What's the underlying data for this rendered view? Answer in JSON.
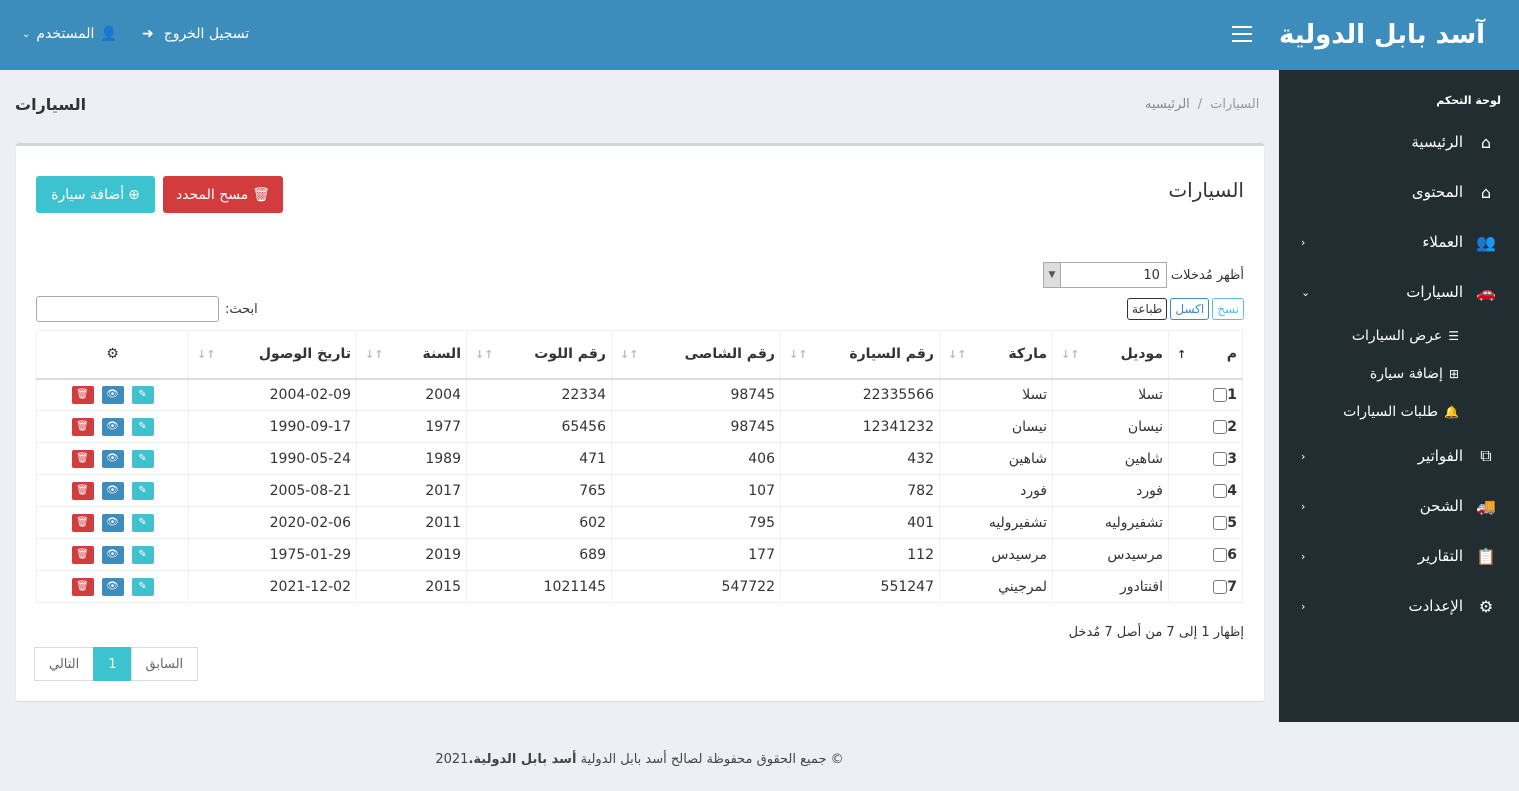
{
  "brand": "آسد بابل الدولية",
  "header": {
    "user_label": "المستخدم",
    "logout_label": "تسجيل الخروج"
  },
  "sidebar": {
    "heading": "لوحة التحكم",
    "items": [
      {
        "label": "الرئيسية",
        "icon": "home-icon"
      },
      {
        "label": "المحتوى",
        "icon": "home-icon"
      },
      {
        "label": "العملاء",
        "icon": "users-icon"
      },
      {
        "label": "السيارات",
        "icon": "car-icon"
      },
      {
        "label": "الفواتير",
        "icon": "copy-icon"
      },
      {
        "label": "الشحن",
        "icon": "truck-icon"
      },
      {
        "label": "التقارير",
        "icon": "clipboard-icon"
      },
      {
        "label": "الإعدادت",
        "icon": "gear-icon"
      }
    ],
    "subitems": [
      {
        "label": "عرض السيارات",
        "icon": "list-icon"
      },
      {
        "label": "إضافة سيارة",
        "icon": "plus-square-icon"
      },
      {
        "label": "طلبات السيارات",
        "icon": "bell-icon"
      }
    ]
  },
  "page": {
    "title": "السيارات",
    "breadcrumb": [
      "الرئيسيه",
      "السيارات"
    ]
  },
  "box": {
    "title": "السيارات",
    "add_button": "أضافة سيارة",
    "delete_button": "مسح المحدد",
    "length_label": "أظهر مُدخلات",
    "length_value": "10",
    "search_label": "ابحث:",
    "export": {
      "copy": "نسخ",
      "excel": "اكسل",
      "print": "طباعة"
    },
    "info": "إظهار 1 إلى 7 من أصل 7 مُدخل",
    "pager": {
      "prev": "السابق",
      "current": "1",
      "next": "التالي"
    }
  },
  "table": {
    "columns": [
      "م",
      "موديل",
      "ماركة",
      "رقم السيارة",
      "رقم الشاصى",
      "رقم اللوت",
      "السنة",
      "تاريخ الوصول"
    ],
    "rows": [
      [
        "1",
        "تسلا",
        "تسلا",
        "22335566",
        "98745",
        "22334",
        "2004",
        "2004-02-09"
      ],
      [
        "2",
        "نيسان",
        "نيسان",
        "12341232",
        "98745",
        "65456",
        "1977",
        "1990-09-17"
      ],
      [
        "3",
        "شاهين",
        "شاهين",
        "432",
        "406",
        "471",
        "1989",
        "1990-05-24"
      ],
      [
        "4",
        "فورد",
        "فورد",
        "782",
        "107",
        "765",
        "2017",
        "2005-08-21"
      ],
      [
        "5",
        "تشفيروليه",
        "تشفيروليه",
        "401",
        "795",
        "602",
        "2011",
        "2020-02-06"
      ],
      [
        "6",
        "مرسيدس",
        "مرسيدس",
        "112",
        "177",
        "689",
        "2019",
        "1975-01-29"
      ],
      [
        "7",
        "افنتادور",
        "لمرجيني",
        "551247",
        "547722",
        "1021145",
        "2015",
        "2021-12-02"
      ]
    ]
  },
  "footer": {
    "text": "© جميع الحقوق محفوظة لصالح أسد بابل الدولية",
    "brand": "أسد بابل الدولية.",
    "year": "2021"
  }
}
